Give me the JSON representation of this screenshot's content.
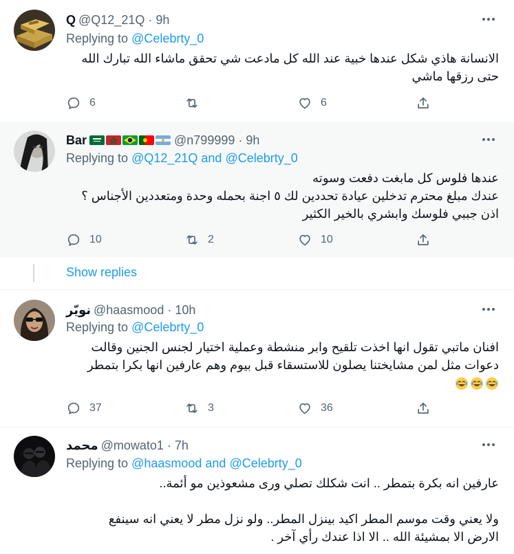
{
  "tweets": [
    {
      "name": "Q",
      "handle": "@Q12_21Q",
      "dot": "·",
      "time": "9h",
      "replying_prefix": "Replying to",
      "replying_mentions": "@Celebrty_0",
      "lines": [
        "الانسانة هاذي شكل عندها خبية عند الله كل مادعت شي تحقق ماشاء الله تبارك الله",
        "حتى رزقها ماشي"
      ],
      "reply_count": "6",
      "retweet_count": "",
      "like_count": "6"
    },
    {
      "name": "Bar",
      "flags": [
        "saudi-flag",
        "morocco-flag",
        "brazil-flag",
        "portugal-flag",
        "argentina-flag"
      ],
      "handle": "@n799999",
      "dot": "·",
      "time": "9h",
      "replying_prefix": "Replying to",
      "replying_mentions": "@Q12_21Q and @Celebrty_0",
      "lines": [
        "عندها فلوس كل مابغت دفعت وسوته",
        "عندك مبلغ محترم تدخلين عيادة تحددين لك ٥ اجنة بحمله وحدة ومتعددين الأجناس ؟",
        "اذن جببي فلوسك وابشري بالخير الكثير"
      ],
      "reply_count": "10",
      "retweet_count": "2",
      "like_count": "10"
    },
    {
      "name": "نويّر",
      "handle": "@haasmood",
      "dot": "·",
      "time": "10h",
      "replying_prefix": "Replying to",
      "replying_mentions": "@Celebrty_0",
      "lines": [
        "افنان ماتبي تقول انها اخذت تلقيح وابر منشطة وعملية اختيار لجنس الجنين وقالت",
        "دعوات مثل لمن مشايختنا يصلون للاستسقاء قبل بيوم وهم عارفين انها بكرا بتمطر"
      ],
      "emoji_icon": "laughing-crying-emoji",
      "reply_count": "37",
      "retweet_count": "3",
      "like_count": "36"
    },
    {
      "name": "محمد",
      "handle": "@mowato1",
      "dot": "·",
      "time": "7h",
      "replying_prefix": "Replying to",
      "replying_mentions": "@haasmood and @Celebrty_0",
      "lines": [
        "عارفين انه بكرة بتمطر .. انت شكلك تصلي ورى مشعوذين مو أئمة..",
        "",
        "ولا يعني وقت موسم المطر اكيد بينزل المطر.. ولو نزل مطر لا يعني انه سينفع",
        "الارض الا بمشيئة الله .. الا اذا عندك رأي آخر ."
      ]
    }
  ],
  "show_replies": "Show replies",
  "colors": {
    "accent": "#1d9bf0",
    "secondary_text": "#536471",
    "highlight_bg": "#f7f9f9"
  }
}
